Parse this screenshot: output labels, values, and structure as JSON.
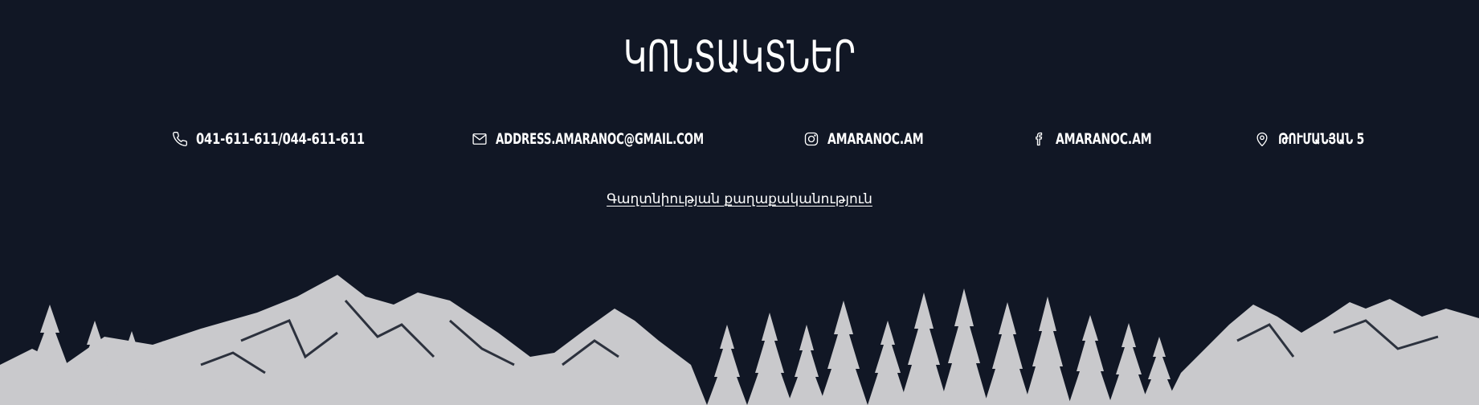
{
  "section": {
    "title": "ԿՈՆՏԱԿՏՆԵՐ"
  },
  "contacts": {
    "phone": {
      "icon": "phone-icon",
      "text": "041-611-611/044-611-611"
    },
    "email": {
      "icon": "mail-icon",
      "text": "ADDRESS.AMARANOC@GMAIL.COM"
    },
    "instagram": {
      "icon": "instagram-icon",
      "text": "AMARANOC.AM"
    },
    "facebook": {
      "icon": "facebook-icon",
      "text": "AMARANOC.AM"
    },
    "location": {
      "icon": "location-pin-icon",
      "text": "ԹՈՒՄԱՆՅԱՆ 5"
    }
  },
  "privacy": {
    "link": "Գաղտնիության քաղաքականություն"
  },
  "colors": {
    "background": "#111725",
    "text": "#ffffff",
    "illustration": "#c9c9cc"
  }
}
